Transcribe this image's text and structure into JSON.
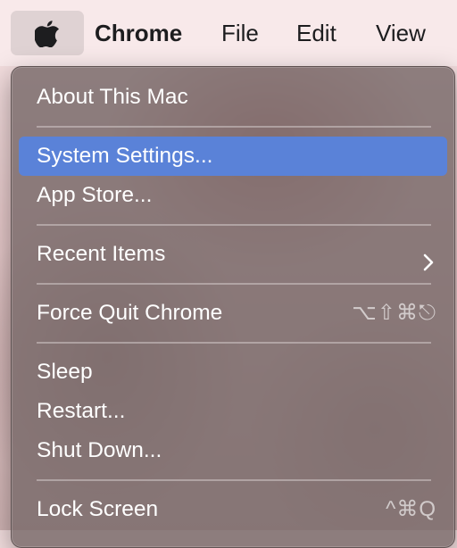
{
  "menubar": {
    "apple_icon": "apple-logo-icon",
    "items": [
      "Chrome",
      "File",
      "Edit",
      "View"
    ]
  },
  "apple_menu": {
    "items": [
      {
        "label": "About This Mac"
      },
      {
        "label": "System Settings...",
        "highlighted": true
      },
      {
        "label": "App Store..."
      },
      {
        "label": "Recent Items",
        "submenu_icon": "chevron-right-icon"
      },
      {
        "label": "Force Quit Chrome",
        "shortcut": "⌥⇧⌘⎋"
      },
      {
        "label": "Sleep"
      },
      {
        "label": "Restart..."
      },
      {
        "label": "Shut Down..."
      },
      {
        "label": "Lock Screen",
        "shortcut": "^⌘Q"
      }
    ]
  },
  "colors": {
    "highlight": "#5a82d8",
    "menu_bg": "#766868",
    "menu_text": "#ffffff"
  }
}
